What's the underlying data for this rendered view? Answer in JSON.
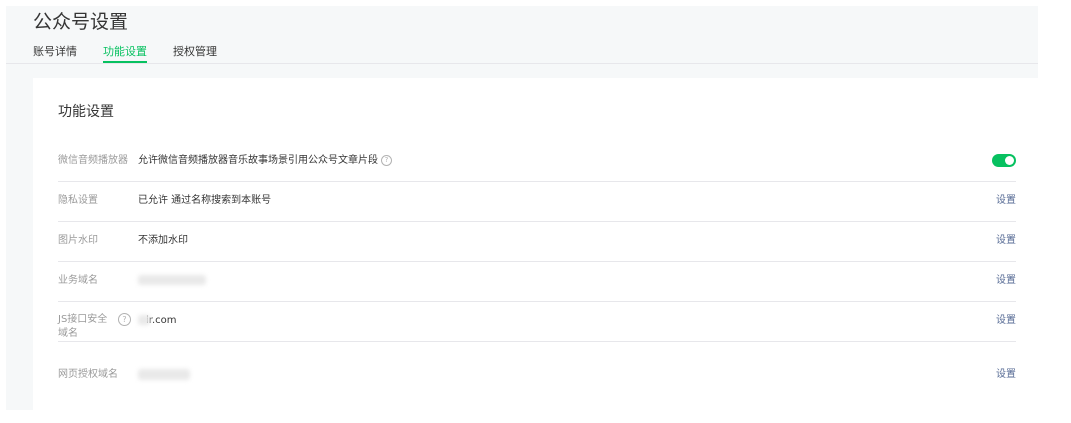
{
  "page": {
    "title": "公众号设置"
  },
  "tabs": [
    {
      "label": "账号详情",
      "active": false
    },
    {
      "label": "功能设置",
      "active": true
    },
    {
      "label": "授权管理",
      "active": false
    }
  ],
  "accent_color": "#07c160",
  "link_color": "#576b95",
  "section": {
    "title": "功能设置",
    "rows": [
      {
        "label": "微信音频播放器",
        "value": "允许微信音频播放器音乐故事场景引用公众号文章片段",
        "action": "toggle",
        "toggle_on": true
      },
      {
        "label": "隐私设置",
        "value": "已允许 通过名称搜索到本账号",
        "action": "设置"
      },
      {
        "label": "图片水印",
        "value": "不添加水印",
        "action": "设置"
      },
      {
        "label": "业务域名",
        "value": "",
        "action": "设置"
      },
      {
        "label": "JS接口安全域名",
        "value": "ir.com",
        "action": "设置"
      },
      {
        "label": "网页授权域名",
        "value": "",
        "action": "设置"
      }
    ]
  }
}
